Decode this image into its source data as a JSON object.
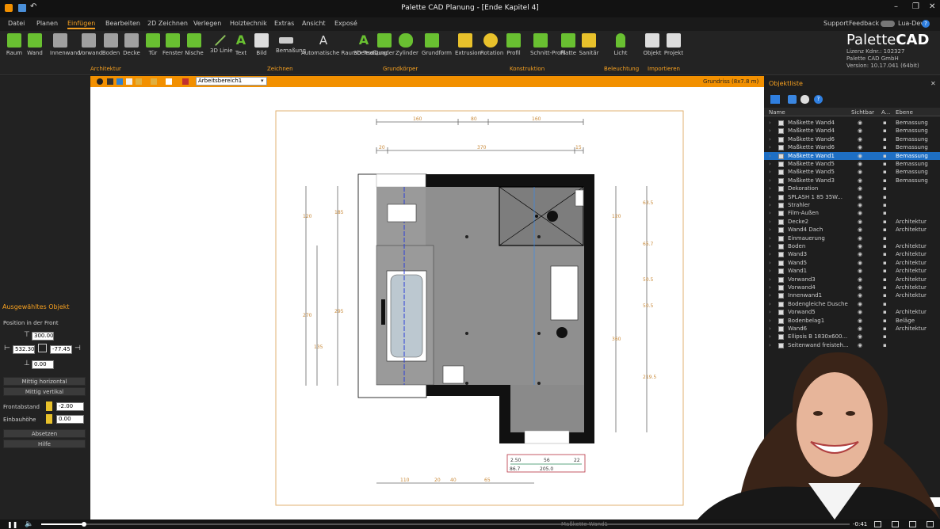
{
  "window": {
    "title": "Palette CAD Planung - [Ende Kapitel 4]"
  },
  "menu": {
    "items": [
      "Datei",
      "Planen",
      "Einfügen",
      "Bearbeiten",
      "2D Zeichnen",
      "Verlegen",
      "Holztechnik",
      "Extras",
      "Ansicht",
      "Exposé"
    ],
    "active": "Einfügen",
    "right": [
      "Support",
      "Feedback",
      "Lua-Dev"
    ]
  },
  "ribbon": {
    "buttons": [
      "Raum",
      "Wand",
      "Innenwand",
      "Vorwand",
      "Boden",
      "Decke",
      "Tür",
      "Fenster",
      "Nische",
      "3D Linie",
      "Text",
      "Bild",
      "Bemaßung",
      "Automatische Raumbemaßung",
      "3D Text",
      "Quader",
      "Zylinder",
      "Grundform",
      "Extrusion",
      "Rotation",
      "Profil",
      "Schnitt-Profil",
      "Platte",
      "Sanitär",
      "Licht",
      "Objekt",
      "Projekt"
    ],
    "groups": [
      "Architektur",
      "Zeichnen",
      "Grundkörper",
      "Konstruktion",
      "Beleuchtung",
      "Importieren"
    ]
  },
  "logo": {
    "brand1": "Palette",
    "brand2": "CAD",
    "licence": "Lizenz Kdnr.: 102327",
    "company": "Palette CAD GmbH",
    "version": "Version: 10.17.041 (64bit)"
  },
  "toolbar": {
    "workspace": "Arbeitsbereich1",
    "view": "Grundriss (8x7.8 m)"
  },
  "sidebar": {
    "section": "Ausgewähltes Objekt",
    "position_label": "Position in der Front",
    "top": "300.00",
    "left": "532.30",
    "right": "-77.45",
    "bottom": "0.00",
    "btn_h": "Mittig horizontal",
    "btn_v": "Mittig vertikal",
    "front_label": "Frontabstand",
    "front_val": "-2.00",
    "einbau_label": "Einbauhöhe",
    "einbau_val": "0.00",
    "btn_absetzen": "Absetzen",
    "btn_hilfe": "Hilfe"
  },
  "objlist": {
    "title": "Objektliste",
    "cols": [
      "Name",
      "Sichtbar",
      "A...",
      "Ebene"
    ],
    "rows": [
      {
        "name": "Maßkette Wand4",
        "layer": "Bemassung"
      },
      {
        "name": "Maßkette Wand4",
        "layer": "Bemassung"
      },
      {
        "name": "Maßkette Wand6",
        "layer": "Bemassung"
      },
      {
        "name": "Maßkette Wand6",
        "layer": "Bemassung"
      },
      {
        "name": "Maßkette Wand1",
        "layer": "Bemassung"
      },
      {
        "name": "Maßkette Wand5",
        "layer": "Bemassung"
      },
      {
        "name": "Maßkette Wand5",
        "layer": "Bemassung"
      },
      {
        "name": "Maßkette Wand3",
        "layer": "Bemassung"
      },
      {
        "name": "Dekoration",
        "layer": ""
      },
      {
        "name": "SPLASH 1  85 35W...",
        "layer": ""
      },
      {
        "name": "Strahler",
        "layer": ""
      },
      {
        "name": "Film-Außen",
        "layer": ""
      },
      {
        "name": "Decke2",
        "layer": "Architektur"
      },
      {
        "name": "Wand4 Dach",
        "layer": "Architektur"
      },
      {
        "name": "Einmauerung",
        "layer": ""
      },
      {
        "name": "Boden",
        "layer": "Architektur"
      },
      {
        "name": "Wand3",
        "layer": "Architektur"
      },
      {
        "name": "Wand5",
        "layer": "Architektur"
      },
      {
        "name": "Wand1",
        "layer": "Architektur"
      },
      {
        "name": "Vorwand3",
        "layer": "Architektur"
      },
      {
        "name": "Vorwand4",
        "layer": "Architektur"
      },
      {
        "name": "Innenwand1",
        "layer": "Architektur"
      },
      {
        "name": "Bodengleiche Dusche",
        "layer": ""
      },
      {
        "name": "Vorwand5",
        "layer": "Architektur"
      },
      {
        "name": "Bodenbelag1",
        "layer": "Beläge"
      },
      {
        "name": "Wand6",
        "layer": "Architektur"
      },
      {
        "name": "Ellipsis B 1830x600...",
        "layer": ""
      },
      {
        "name": "Seitenwand freisteh...",
        "layer": ""
      }
    ],
    "selected_index": 4,
    "sort": "Name"
  },
  "status": {
    "time": "-0:41",
    "sel": "Maßkette Wand1"
  },
  "dims": {
    "top1": [
      "160",
      "80",
      "160"
    ],
    "top2": [
      "20",
      "370",
      "15"
    ],
    "left1": [
      "120",
      "270",
      "185",
      "295",
      "135"
    ],
    "right1": [
      "120",
      "360",
      "63.5",
      "65.7",
      "50.5",
      "50.5",
      "219.5"
    ],
    "bottom1": [
      "110",
      "20",
      "40",
      "65"
    ],
    "detail": [
      "86.7",
      "205.0",
      "56",
      "22",
      "2.50"
    ]
  },
  "colors": {
    "orange": "#f29000",
    "green": "#69c031",
    "accent": "#f6a020",
    "sel": "#1e6fc4"
  }
}
